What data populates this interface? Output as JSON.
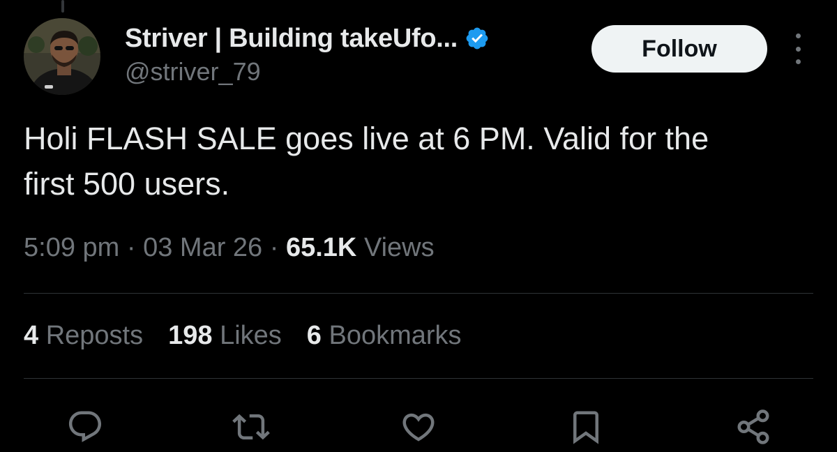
{
  "author": {
    "display_name": "Striver | Building takeUfo...",
    "handle": "@striver_79",
    "verified": true
  },
  "follow_label": "Follow",
  "tweet": {
    "text": "Holi FLASH SALE goes live at 6 PM. Valid for the\nfirst 500 users."
  },
  "meta": {
    "time": "5:09 pm",
    "separator": "·",
    "date": "03 Mar 26",
    "views_count": "65.1K",
    "views_label": "Views"
  },
  "stats": {
    "reposts_count": "4",
    "reposts_label": "Reposts",
    "likes_count": "198",
    "likes_label": "Likes",
    "bookmarks_count": "6",
    "bookmarks_label": "Bookmarks"
  },
  "actions": [
    "reply-icon",
    "repost-icon",
    "like-icon",
    "bookmark-icon",
    "share-icon"
  ],
  "colors": {
    "background": "#000000",
    "text_primary": "#e7e9ea",
    "text_secondary": "#71767b",
    "verified_badge": "#1d9bf0",
    "follow_bg": "#eff3f4",
    "divider": "#2f3336"
  }
}
